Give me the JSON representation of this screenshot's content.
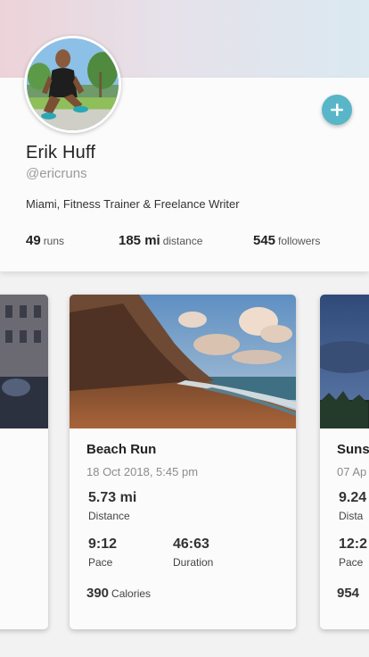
{
  "profile": {
    "name": "Erik Huff",
    "handle": "@ericruns",
    "bio": "Miami, Fitness Trainer & Freelance Writer",
    "stats": [
      {
        "value": "49",
        "label": "runs"
      },
      {
        "value": "185 mi",
        "label": "distance"
      },
      {
        "value": "545",
        "label": "followers"
      }
    ],
    "add_icon": "plus-icon",
    "accent_color": "#58b6c8"
  },
  "run_cards": [
    {
      "title": "Beach Run",
      "date": "18 Oct 2018, 5:45 pm",
      "distance_value": "5.73 mi",
      "distance_label": "Distance",
      "pace_value": "9:12",
      "pace_label": "Pace",
      "duration_value": "46:63",
      "duration_label": "Duration",
      "calories_value": "390",
      "calories_label": "Calories"
    },
    {
      "title": "Suns",
      "date": "07 Ap",
      "distance_value": "9.24",
      "distance_label": "Dista",
      "pace_value": "12:2",
      "pace_label": "Pace",
      "calories_value": "954"
    }
  ]
}
